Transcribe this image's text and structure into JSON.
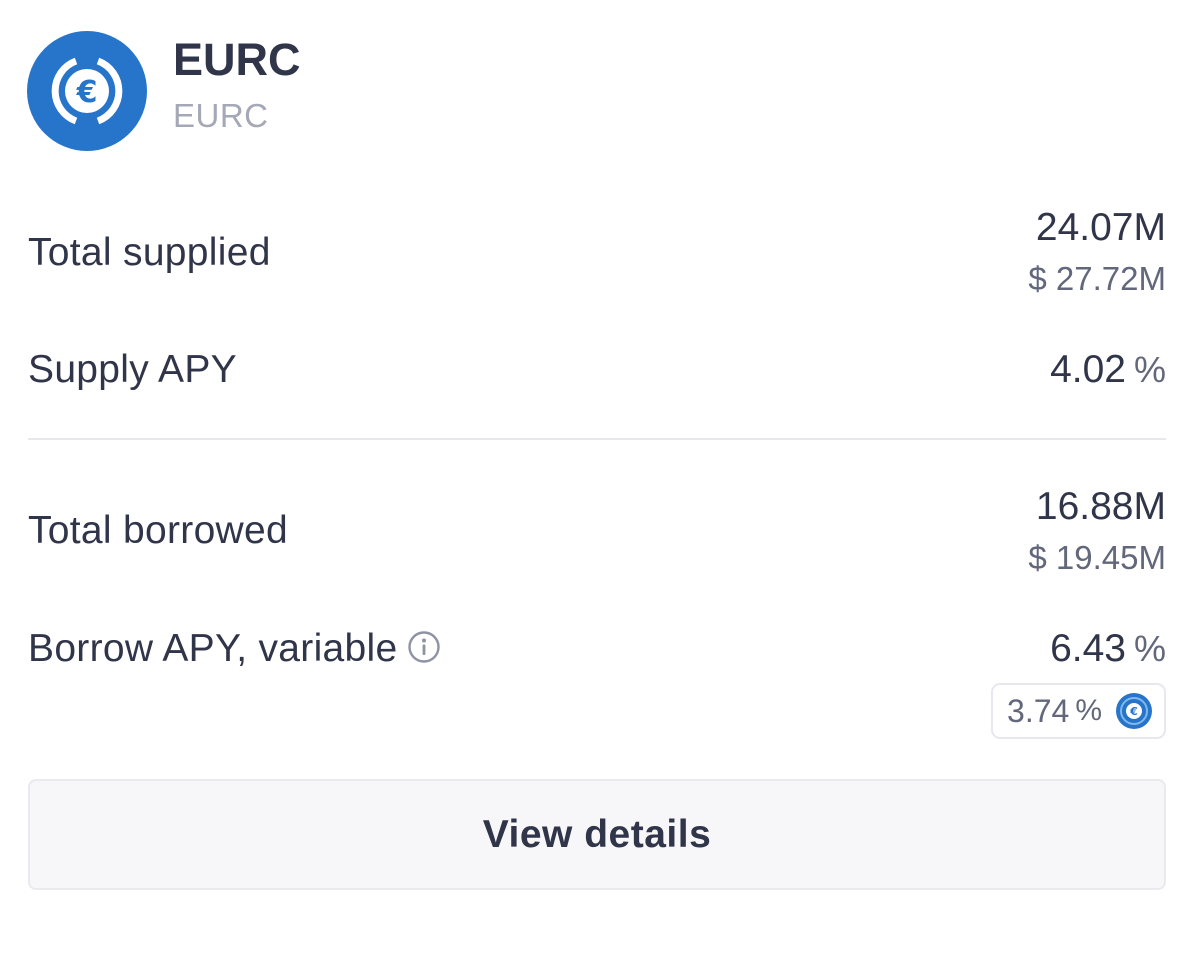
{
  "asset": {
    "symbol": "EURC",
    "name": "EURC",
    "icon": "euro-coin-icon",
    "brand_color": "#2775ca"
  },
  "total_supplied": {
    "label": "Total supplied",
    "amount": "24.07M",
    "usd": "$ 27.72M"
  },
  "supply_apy": {
    "label": "Supply APY",
    "value": "4.02",
    "unit": "%"
  },
  "total_borrowed": {
    "label": "Total borrowed",
    "amount": "16.88M",
    "usd": "$ 19.45M"
  },
  "borrow_apy": {
    "label": "Borrow APY, variable",
    "info_icon": "info-icon",
    "value": "6.43",
    "unit": "%",
    "incentive": {
      "value": "3.74",
      "unit": "%",
      "icon": "euro-coin-icon"
    }
  },
  "actions": {
    "view_details_label": "View details"
  },
  "colors": {
    "text_primary": "#303549",
    "text_secondary": "#62677b",
    "text_muted": "#a5a8b6",
    "divider": "#e6e8ee",
    "button_bg": "#f7f7f9"
  }
}
